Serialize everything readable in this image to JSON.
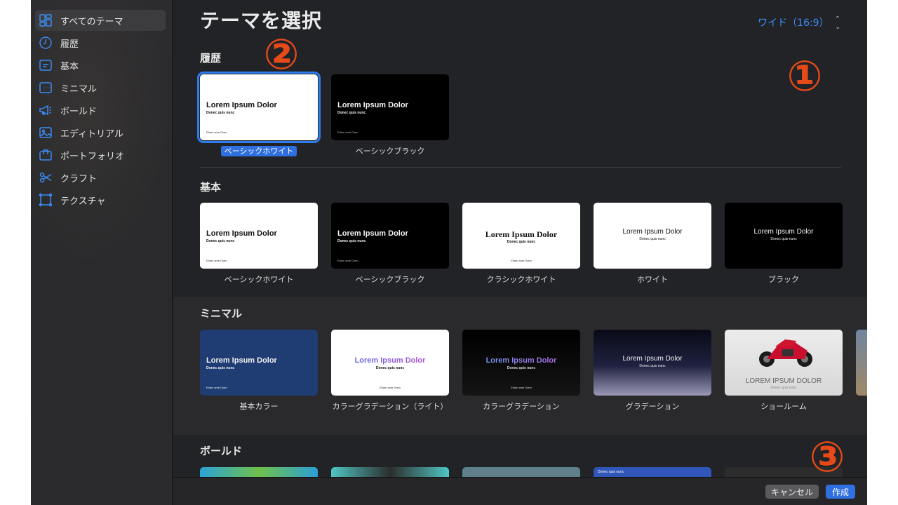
{
  "sidebar": {
    "items": [
      {
        "label": "すべてのテーマ",
        "icon": "grid-icon"
      },
      {
        "label": "履歴",
        "icon": "clock-icon"
      },
      {
        "label": "基本",
        "icon": "text-box-icon"
      },
      {
        "label": "ミニマル",
        "icon": "ellipsis-box-icon"
      },
      {
        "label": "ボールド",
        "icon": "megaphone-icon"
      },
      {
        "label": "エディトリアル",
        "icon": "image-icon"
      },
      {
        "label": "ポートフォリオ",
        "icon": "briefcase-icon"
      },
      {
        "label": "クラフト",
        "icon": "scissors-icon"
      },
      {
        "label": "テクスチャ",
        "icon": "texture-frame-icon"
      }
    ]
  },
  "header": {
    "title": "テーマを選択",
    "size_select": "ワイド（16:9）"
  },
  "sections": {
    "history": {
      "title": "履歴",
      "themes": [
        {
          "name": "ベーシックホワイト",
          "style": "white",
          "title": "Lorem Ipsum Dolor",
          "subtitle": "Donec quis nunc",
          "footer": "Etiam ante Diam",
          "selected": true
        },
        {
          "name": "ベーシックブラック",
          "style": "black",
          "title": "Lorem Ipsum Dolor",
          "subtitle": "Donec quis nunc",
          "footer": "Etiam ante Diam"
        }
      ]
    },
    "basic": {
      "title": "基本",
      "themes": [
        {
          "name": "ベーシックホワイト",
          "style": "white",
          "title": "Lorem Ipsum Dolor",
          "subtitle": "Donec quis nunc",
          "footer": "Etiam ante Diam"
        },
        {
          "name": "ベーシックブラック",
          "style": "black",
          "title": "Lorem Ipsum Dolor",
          "subtitle": "Donec quis nunc",
          "footer": "Etiam ante Diam"
        },
        {
          "name": "クラシックホワイト",
          "style": "white center serif",
          "title": "Lorem Ipsum Dolor",
          "subtitle": "Donec quis nunc",
          "footer": "Etiam ante Diam"
        },
        {
          "name": "ホワイト",
          "style": "white center",
          "title": "Lorem Ipsum Dolor",
          "subtitle": "Donec quis nunc"
        },
        {
          "name": "ブラック",
          "style": "black center",
          "title": "Lorem Ipsum Dolor",
          "subtitle": "Donec quis nunc"
        }
      ]
    },
    "minimal": {
      "title": "ミニマル",
      "themes": [
        {
          "name": "基本カラー",
          "style": "navy",
          "title": "Lorem Ipsum Dolor",
          "subtitle": "Donec quis nunc",
          "footer": "Etiam ante Diam"
        },
        {
          "name": "カラーグラデーション（ライト）",
          "style": "grad-light center",
          "title": "Lorem Ipsum Dolor",
          "subtitle": "Donec quis nunc",
          "footer": "Etiam ante Diam"
        },
        {
          "name": "カラーグラデーション",
          "style": "grad-dark center",
          "title": "Lorem Ipsum Dolor",
          "subtitle": "Donec quis nunc",
          "footer": "Etiam ante Diam"
        },
        {
          "name": "グラデーション",
          "style": "gradient center",
          "title": "Lorem Ipsum Dolor",
          "subtitle": "Donec quis nunc"
        },
        {
          "name": "ショールーム",
          "style": "showroom center",
          "title": "LOREM IPSUM DOLOR",
          "subtitle": "Donec quis nunc"
        }
      ]
    },
    "bold": {
      "title": "ボールド",
      "partial_text": "Donec quis nunc"
    }
  },
  "footer": {
    "cancel_label": "キャンセル",
    "create_label": "作成"
  },
  "annotations": [
    "①",
    "②",
    "③"
  ],
  "colors": {
    "accent": "#3b8cf5",
    "selection": "#2f6fe0",
    "annotation": "#e64a19"
  }
}
